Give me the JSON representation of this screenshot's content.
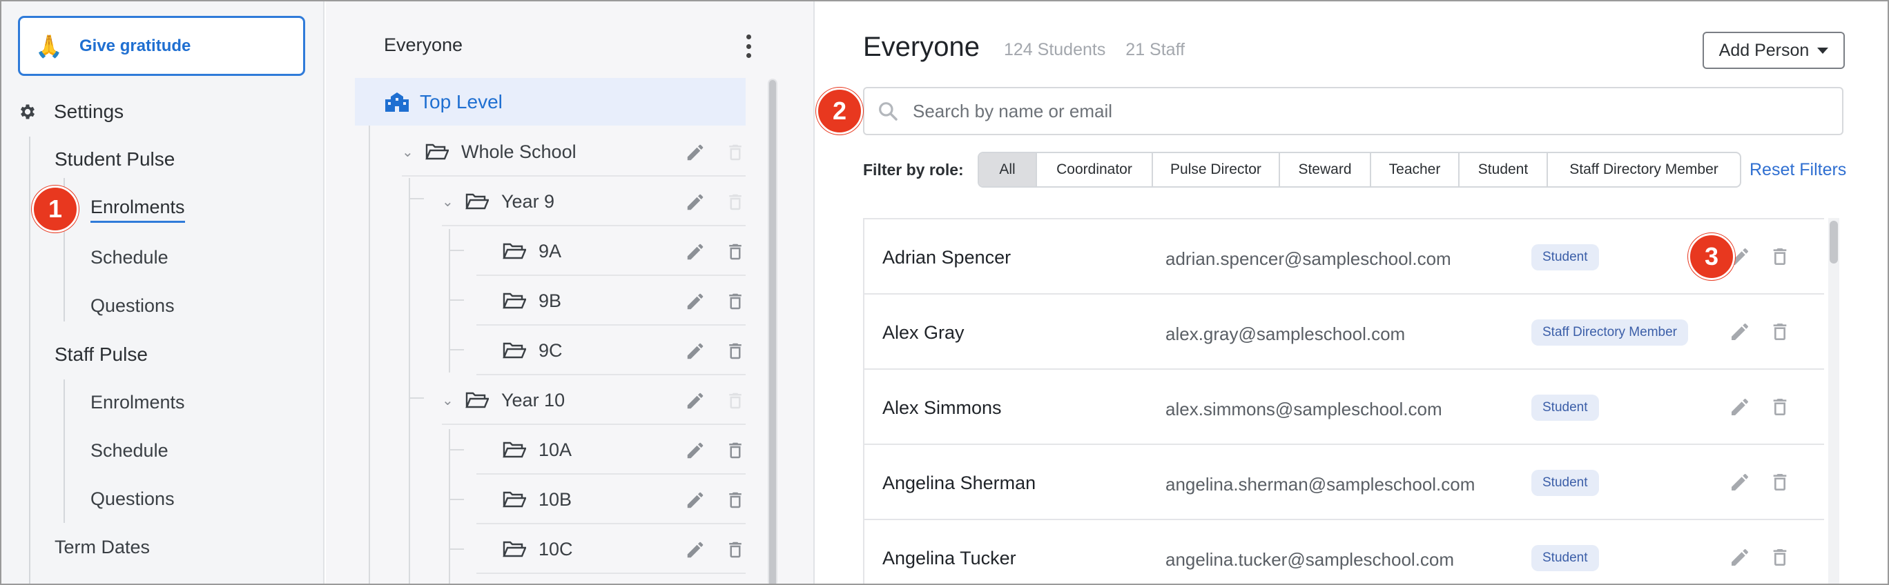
{
  "sidebar": {
    "gratitude_button": "Give gratitude",
    "settings_label": "Settings",
    "groups": [
      {
        "label": "Student Pulse",
        "items": [
          {
            "label": "Enrolments"
          },
          {
            "label": "Schedule"
          },
          {
            "label": "Questions"
          }
        ]
      },
      {
        "label": "Staff Pulse",
        "items": [
          {
            "label": "Enrolments"
          },
          {
            "label": "Schedule"
          },
          {
            "label": "Questions"
          }
        ]
      }
    ],
    "term_dates": "Term Dates"
  },
  "markers": [
    "1",
    "2",
    "3"
  ],
  "tree": {
    "header": "Everyone",
    "top_level": "Top Level",
    "nodes": [
      {
        "label": "Whole School"
      },
      {
        "label": "Year 9"
      },
      {
        "label": "9A"
      },
      {
        "label": "9B"
      },
      {
        "label": "9C"
      },
      {
        "label": "Year 10"
      },
      {
        "label": "10A"
      },
      {
        "label": "10B"
      },
      {
        "label": "10C"
      }
    ]
  },
  "main": {
    "title": "Everyone",
    "students_count": "124 Students",
    "staff_count": "21 Staff",
    "add_person": "Add Person",
    "search_placeholder": "Search by name or email",
    "search_value": "",
    "filter_label": "Filter by role:",
    "filters": [
      {
        "label": "All"
      },
      {
        "label": "Coordinator"
      },
      {
        "label": "Pulse Director"
      },
      {
        "label": "Steward"
      },
      {
        "label": "Teacher"
      },
      {
        "label": "Student"
      },
      {
        "label": "Staff Directory Member"
      }
    ],
    "reset_filters": "Reset Filters",
    "people": [
      {
        "name": "Adrian Spencer",
        "email": "adrian.spencer@sampleschool.com",
        "role": "Student"
      },
      {
        "name": "Alex Gray",
        "email": "alex.gray@sampleschool.com",
        "role": "Staff Directory Member"
      },
      {
        "name": "Alex Simmons",
        "email": "alex.simmons@sampleschool.com",
        "role": "Student"
      },
      {
        "name": "Angelina Sherman",
        "email": "angelina.sherman@sampleschool.com",
        "role": "Student"
      },
      {
        "name": "Angelina Tucker",
        "email": "angelina.tucker@sampleschool.com",
        "role": "Student"
      }
    ]
  },
  "icons": {
    "gratitude": "praying-hands-icon",
    "settings": "gear-icon",
    "top_level": "school-building-icon",
    "folder": "folder-open-icon",
    "edit": "pencil-icon",
    "delete": "trash-icon",
    "search": "search-icon",
    "kebab": "more-vertical-icon"
  },
  "colors": {
    "accent": "#2f7bd9",
    "marker": "#e8381f",
    "role_badge_bg": "#e6ecf8"
  }
}
